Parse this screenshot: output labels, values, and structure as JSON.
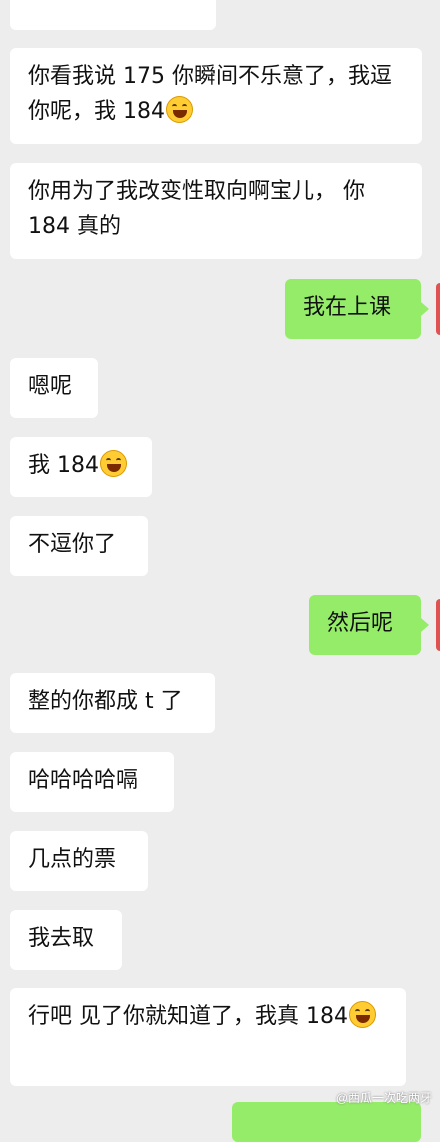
{
  "messages": [
    {
      "side": "in",
      "text": "你看我说 175 你瞬间不乐意了，我逗你呢，我 184",
      "emoji": true
    },
    {
      "side": "in",
      "text": "你用为了我改变性取向啊宝儿， 你 184 真的",
      "emoji": false
    },
    {
      "side": "out",
      "text": "我在上课",
      "emoji": false
    },
    {
      "side": "in",
      "text": "嗯呢",
      "emoji": false
    },
    {
      "side": "in",
      "text": "我 184",
      "emoji": true
    },
    {
      "side": "in",
      "text": "不逗你了",
      "emoji": false
    },
    {
      "side": "out",
      "text": "然后呢",
      "emoji": false
    },
    {
      "side": "in",
      "text": "整的你都成 t 了",
      "emoji": false
    },
    {
      "side": "in",
      "text": "哈哈哈哈嗝",
      "emoji": false
    },
    {
      "side": "in",
      "text": "几点的票",
      "emoji": false
    },
    {
      "side": "in",
      "text": "我去取",
      "emoji": false
    },
    {
      "side": "in",
      "text": "行吧 见了你就知道了，我真 184",
      "emoji": true
    }
  ],
  "watermark": "@西瓜一次吃两牙",
  "emoji_name": "tears-of-joy-icon",
  "colors": {
    "background": "#ededed",
    "incoming": "#ffffff",
    "outgoing": "#95ec69",
    "avatar": "#e05252"
  }
}
